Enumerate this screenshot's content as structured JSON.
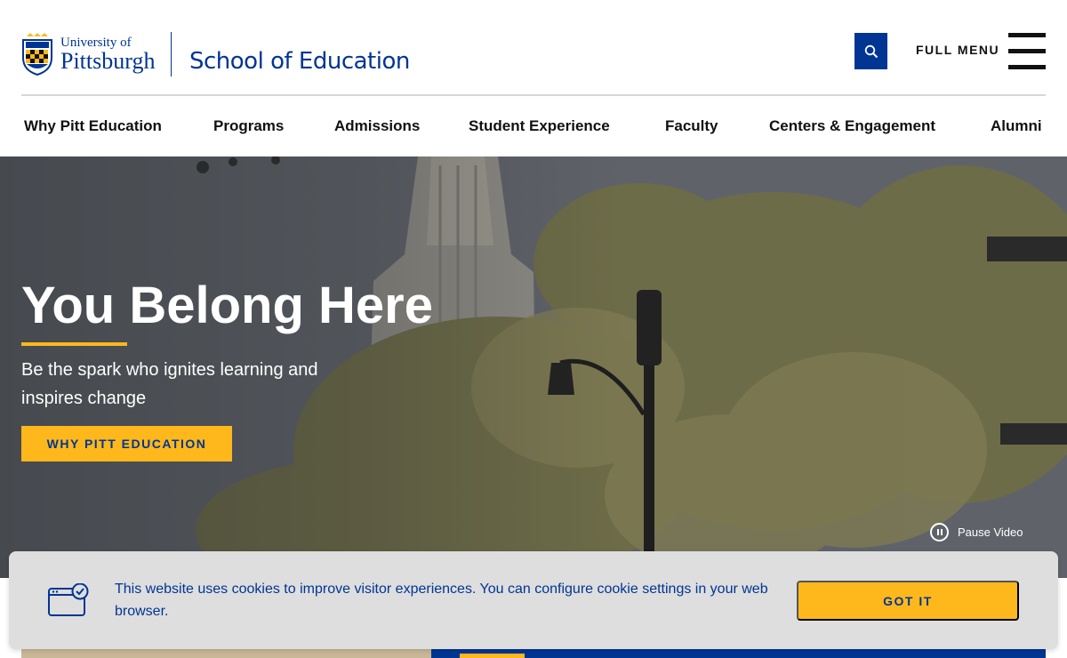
{
  "header": {
    "university_line1": "University of",
    "university_line2": "Pittsburgh",
    "school_name": "School of Education",
    "full_menu_label": "FULL MENU",
    "search_icon": "search-icon",
    "menu_icon": "hamburger-icon"
  },
  "nav": {
    "items": [
      {
        "label": "Why Pitt Education"
      },
      {
        "label": "Programs"
      },
      {
        "label": "Admissions"
      },
      {
        "label": "Student Experience"
      },
      {
        "label": "Faculty"
      },
      {
        "label": "Centers & Engagement"
      },
      {
        "label": "Alumni"
      }
    ]
  },
  "hero": {
    "title": "You Belong Here",
    "subtitle": "Be the spark who ignites learning and inspires change",
    "cta_label": "WHY PITT EDUCATION",
    "pause_label": "Pause Video"
  },
  "cookie": {
    "text": "This website uses cookies to improve visitor experiences. You can configure cookie settings in your web browser.",
    "button_label": "GOT IT",
    "icon": "browser-check-icon"
  },
  "colors": {
    "pitt_blue": "#003594",
    "pitt_gold": "#ffb81c",
    "cookie_bg": "#dedede"
  }
}
